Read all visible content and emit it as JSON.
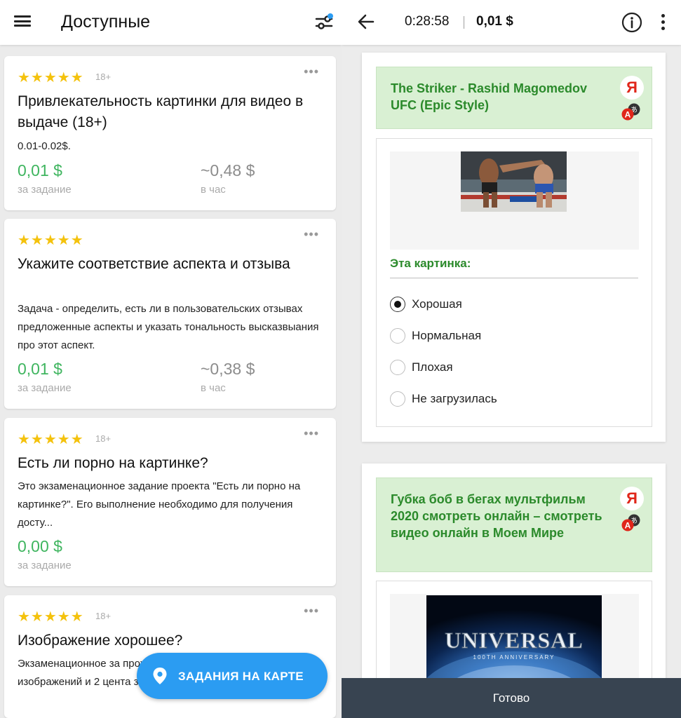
{
  "left": {
    "title": "Доступные",
    "cards": [
      {
        "stars": "★★★★★",
        "age": "18+",
        "more": "•••",
        "title": "Привлекательность картинки для видео в выдаче (18+)",
        "description": "0.01-0.02$.",
        "price": "0,01 $",
        "price_label": "за задание",
        "hourly": "~0,48 $",
        "hourly_label": "в час"
      },
      {
        "stars": "★★★★★",
        "age": "",
        "more": "•••",
        "title": "Укажите соответствие аспекта и отзыва",
        "description": "Задача -  определить, есть ли в пользовательских отзывах предложенные аспекты и указать тональность высказвыания про этот аспект.",
        "price": "0,01 $",
        "price_label": "за задание",
        "hourly": "~0,38 $",
        "hourly_label": "в час"
      },
      {
        "stars": "★★★★★",
        "age": "18+",
        "more": "•••",
        "title": "Есть ли порно на картинке?",
        "description": "Это экзаменационное задание проекта \"Есть ли порно на картинке?\". Его выполнение необходимо для получения досту...",
        "price": "0,00 $",
        "price_label": "за задание"
      },
      {
        "stars": "★★★★★",
        "age": "18+",
        "more": "•••",
        "title": "Изображение хорошее?",
        "description": "Экзаменационное за прохождения будут д разметку 26 изображений и 2 цента за разметку 2..."
      }
    ],
    "map_button": "ЗАДАНИЯ НА КАРТЕ"
  },
  "right": {
    "timer": "0:28:58",
    "separator": "|",
    "earnings": "0,01 $",
    "tasks": [
      {
        "title": "The Striker - Rashid Magomedov UFC (Epic Style)",
        "brand": "Я",
        "question": "Эта картинка:",
        "options": [
          "Хорошая",
          "Нормальная",
          "Плохая",
          "Не загрузилась"
        ],
        "selected": "Хорошая"
      },
      {
        "title": "Губка боб в бегах мультфильм 2020 смотреть онлайн – смотреть видео онлайн в Моем Мире",
        "brand": "Я",
        "thumbnail_text": "UNIVERSAL",
        "thumbnail_subtext": "100TH ANNIVERSARY"
      }
    ],
    "done_button": "Готово"
  },
  "colors": {
    "accent_green": "#3fb55f",
    "title_green": "#2b8a2b",
    "title_bg": "#d9f0d3",
    "star": "#f4c20d",
    "map_button": "#2b9cf2",
    "done_bar": "#384451"
  }
}
